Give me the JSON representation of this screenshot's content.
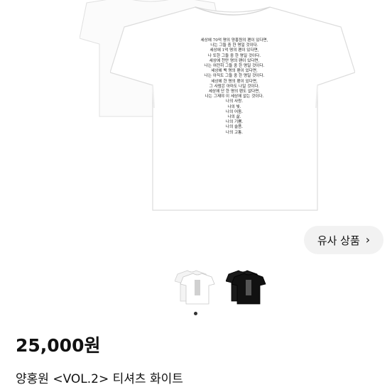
{
  "product_image": {
    "poem_lines": [
      "세상에 70억 명의 양홍원의 팬이 있다면,",
      "나는 그들 중 한 명일 것이다.",
      "세상에 1억 명의 팬이 있다면,",
      "나 또한 그들 중 한 명일 것이다.",
      "세상에 천만 명의 팬이 있다면,",
      "나는 여전히 그들 중 한 명일 것이다.",
      "세상에 백 명의 팬이 있다면,",
      "나는 아직도 그들 중 한 명일 것이다.",
      "세상에 한 명의 팬이 있다면,",
      "그 사람은 아마도 나일 것이다.",
      "세상에 단 한 명의 팬도 없다면,",
      "나는 그제야 이 세상에 없는 것이다.",
      "나의 사랑.",
      "나의 빛.",
      "나의 어둠.",
      "나의 삶.",
      "나의 기쁨.",
      "나의 슬픔.",
      "나의 고통."
    ]
  },
  "similar_button": {
    "label": "유사 상품"
  },
  "thumbnails": [
    {
      "name": "white-variant",
      "color": "#ffffff"
    },
    {
      "name": "black-variant",
      "color": "#111111"
    }
  ],
  "product": {
    "price": "25,000원",
    "title": "양홍원 <VOL.2> 티셔츠 화이트"
  }
}
